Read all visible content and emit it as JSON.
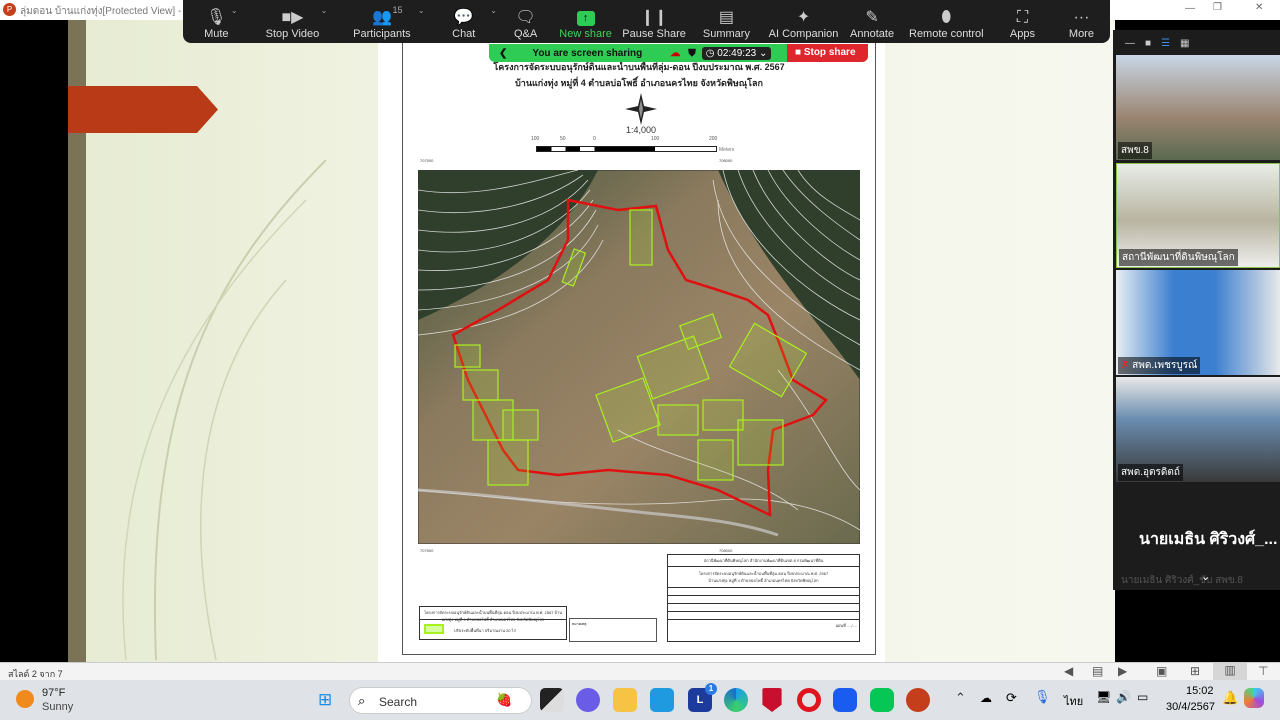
{
  "window": {
    "title": "ลุ่มดอน บ้านแก่งทุ่ง[Protected View] - Po"
  },
  "zoom_toolbar": {
    "items": [
      {
        "label": "Mute",
        "icon": "microphone-icon"
      },
      {
        "label": "Stop Video",
        "icon": "video-camera-icon"
      },
      {
        "label": "Participants",
        "icon": "participants-icon",
        "count": "15"
      },
      {
        "label": "Chat",
        "icon": "chat-icon"
      },
      {
        "label": "Q&A",
        "icon": "qa-icon"
      },
      {
        "label": "New share",
        "icon": "share-up-arrow-icon"
      },
      {
        "label": "Pause Share",
        "icon": "pause-icon"
      },
      {
        "label": "Summary",
        "icon": "summary-doc-icon"
      },
      {
        "label": "AI Companion",
        "icon": "sparkle-icon"
      },
      {
        "label": "Annotate",
        "icon": "pencil-icon"
      },
      {
        "label": "Remote control",
        "icon": "mouse-icon"
      },
      {
        "label": "Apps",
        "icon": "apps-icon"
      },
      {
        "label": "More",
        "icon": "more-dots-icon"
      }
    ],
    "share_status": "You are screen sharing",
    "timer": "02:49:23",
    "stop_share": "Stop share",
    "accent": "#2ecc55",
    "stop_color": "#e0262d"
  },
  "map": {
    "title_line1": "โครงการจัดระบบอนุรักษ์ดินและน้ำบนพื้นที่ลุ่ม-ดอน ปีงบประมาณ พ.ศ. 2567",
    "title_line2": "บ้านแก่งทุ่ง หมู่ที่ 4 ตำบลบ่อโพธิ์ อำเภอนครไทย จังหวัดพิษณุโลก",
    "scale": "1:4,000",
    "scale_ticks": [
      "100",
      "50",
      "0",
      "100",
      "200"
    ],
    "scale_unit": "Meters",
    "coord_left": "707500",
    "coord_right": "708000",
    "compass": {
      "n": "N",
      "s": "S",
      "e": "E",
      "w": "W"
    },
    "legend_title": "โครงการจัดระบบอนุรักษ์ดินและน้ำบนพื้นที่ลุ่ม-ดอน ปีงบประมาณ พ.ศ. 2567 บ้านแก่งทุ่ง หมู่ที่ 4 ตำบลบ่อโพธิ์ อำเภอนครไทย จังหวัดพิษณุโลก",
    "legend_item": "ปรับระดับพื้นที่นา ปริมาณงาน 20 ไร่",
    "note_label": "หมายเหตุ",
    "block_org": "สถานีพัฒนาที่ดินพิษณุโลก สำนักงานพัฒนาที่ดินเขต 8 กรมพัฒนาที่ดิน",
    "block_title": "โครงการจัดระบบอนุรักษ์ดินและน้ำบนพื้นที่ลุ่ม-ดอน ปีงบประมาณ พ.ศ. 2567",
    "block_sub": "บ้านแก่งทุ่ง หมู่ที่ 4 ตำบลบ่อโพธิ์ อำเภอนครไทย จังหวัดพิษณุโลก",
    "block_footer": "แผ่นที่ ..../....",
    "boundary_color": "#e01010",
    "parcel_color": "#a8f020"
  },
  "participants": [
    {
      "name": "สพข.8"
    },
    {
      "name": "สถานีพัฒนาที่ดินพิษณุโลก"
    },
    {
      "name": "สพด.เพชรบูรณ์",
      "muted": true
    },
    {
      "name": "สพด.อุตรดิตถ์"
    }
  ],
  "active_speaker": "นายเมธิน ศิริวงศ์_...",
  "active_speaker_full": "นายเมธิน ศิริวงศ์_ขับ สพข.8",
  "ppt_status": {
    "slide": "สไลด์ 2 จาก 7"
  },
  "taskbar": {
    "weather_temp": "97°F",
    "weather_desc": "Sunny",
    "search": "Search",
    "time": "15:02",
    "date": "30/4/2567",
    "lang": "ไทย",
    "badge": "1"
  }
}
